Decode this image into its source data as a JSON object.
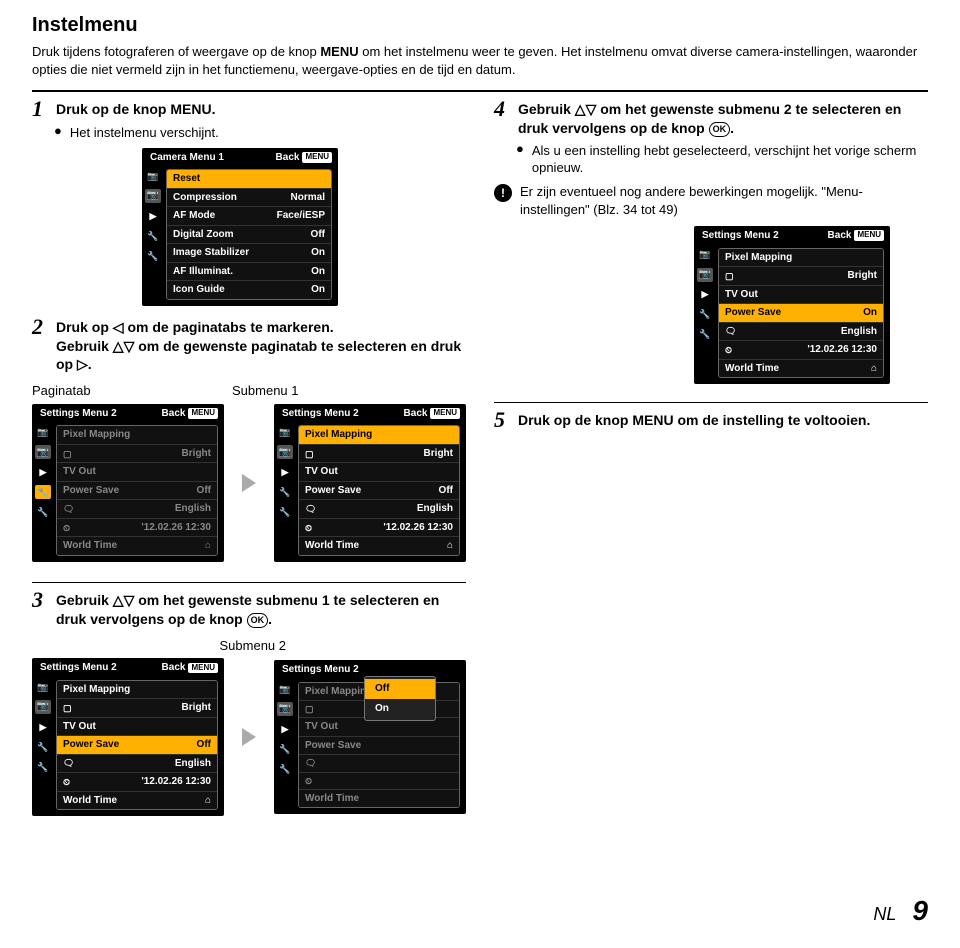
{
  "title": "Instelmenu",
  "intro_before": "Druk tijdens fotograferen of weergave op de knop ",
  "intro_menu": "MENU",
  "intro_after": " om het instelmenu weer te geven. Het instelmenu omvat diverse camera-instellingen, waaronder opties die niet vermeld zijn in het functiemenu, weergave-opties en de tijd en datum.",
  "steps": {
    "s1": {
      "num": "1",
      "text_before": "Druk op de knop ",
      "text_menu": "MENU",
      "text_after": "."
    },
    "s1_bullet": "Het instelmenu verschijnt.",
    "s2": {
      "num": "2",
      "line1_before": "Druk op ",
      "line1_after": " om de paginatabs te markeren.",
      "line2_before": "Gebruik ",
      "line2_after": " om de gewenste paginatab te selecteren en druk op "
    },
    "s2_labels": {
      "left": "Paginatab",
      "right": "Submenu 1"
    },
    "s3": {
      "num": "3",
      "before": "Gebruik ",
      "mid": " om het gewenste submenu 1 te selecteren en druk vervolgens op de knop ",
      "after": "."
    },
    "s3_label": "Submenu 2",
    "s4": {
      "num": "4",
      "before": "Gebruik ",
      "mid": " om het gewenste submenu 2 te selecteren en druk vervolgens op de knop ",
      "after": "."
    },
    "s4_bullet": "Als u een instelling hebt geselecteerd, verschijnt het vorige scherm opnieuw.",
    "s4_note": "Er zijn eventueel nog andere bewerkingen mogelijk. \"Menu-instellingen\" (Blz. 34 tot 49)",
    "s5": {
      "num": "5",
      "before": "Druk op de knop ",
      "menu": "MENU",
      "after": " om de instelling te voltooien."
    }
  },
  "menu_common": {
    "back": "Back",
    "back_pill": "MENU"
  },
  "camera_menu": {
    "title": "Camera Menu 1",
    "rows": [
      {
        "l": "Reset",
        "r": ""
      },
      {
        "l": "Compression",
        "r": "Normal"
      },
      {
        "l": "AF Mode",
        "r": "Face/iESP"
      },
      {
        "l": "Digital Zoom",
        "r": "Off"
      },
      {
        "l": "Image Stabilizer",
        "r": "On"
      },
      {
        "l": "AF Illuminat.",
        "r": "On"
      },
      {
        "l": "Icon Guide",
        "r": "On"
      }
    ]
  },
  "settings_menu": {
    "title": "Settings Menu 2",
    "rows": [
      {
        "l": "Pixel Mapping",
        "r": ""
      },
      {
        "l": "",
        "r": "Bright",
        "icon": "display"
      },
      {
        "l": "TV Out",
        "r": ""
      },
      {
        "l": "Power Save",
        "r": "Off"
      },
      {
        "l": "",
        "r": "English",
        "icon": "lang"
      },
      {
        "l": "",
        "r": "'12.02.26 12:30",
        "icon": "clock"
      },
      {
        "l": "World Time",
        "r": "",
        "icon_r": "home"
      }
    ]
  },
  "settings_menu_on": {
    "title": "Settings Menu 2",
    "rows": [
      {
        "l": "Pixel Mapping",
        "r": ""
      },
      {
        "l": "",
        "r": "Bright",
        "icon": "display"
      },
      {
        "l": "TV Out",
        "r": ""
      },
      {
        "l": "Power Save",
        "r": "On"
      },
      {
        "l": "",
        "r": "English",
        "icon": "lang"
      },
      {
        "l": "",
        "r": "'12.02.26 12:30",
        "icon": "clock"
      },
      {
        "l": "World Time",
        "r": "",
        "icon_r": "home"
      }
    ]
  },
  "popup": {
    "opt1": "Off",
    "opt2": "On"
  },
  "footer": {
    "lang": "NL",
    "page": "9"
  }
}
